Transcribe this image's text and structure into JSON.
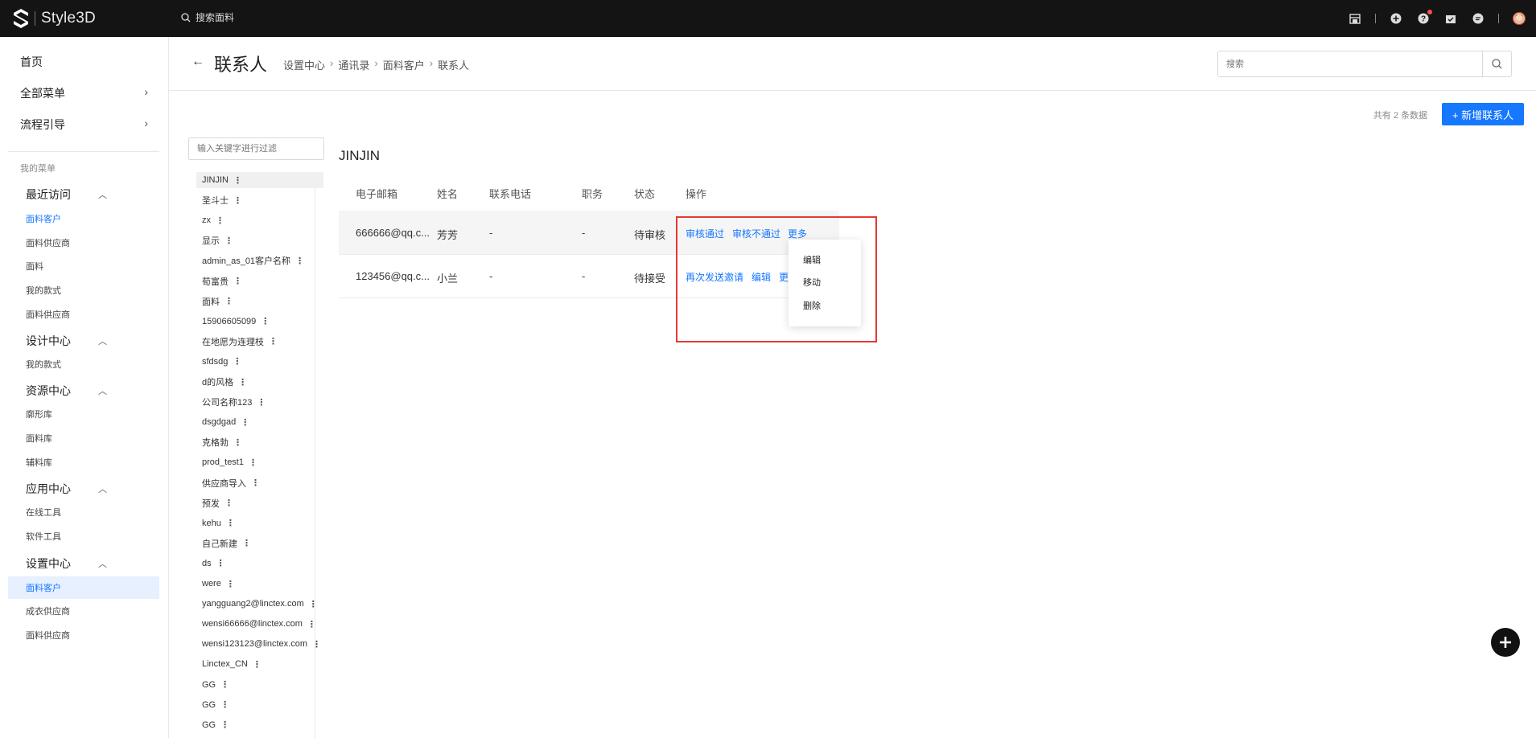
{
  "app": {
    "brand": "Style3D"
  },
  "topbar": {
    "search_label": "搜索面料"
  },
  "sidebar": {
    "home": "首页",
    "all_menu": "全部菜单",
    "flow_guide": "流程引导",
    "my_menu": "我的菜单",
    "groups": [
      {
        "label": "最近访问",
        "items": [
          "面料客户",
          "面料供应商",
          "面料",
          "我的款式",
          "面料供应商"
        ]
      },
      {
        "label": "设计中心",
        "items": [
          "我的款式"
        ]
      },
      {
        "label": "资源中心",
        "items": [
          "廓形库",
          "面料库",
          "辅料库"
        ]
      },
      {
        "label": "应用中心",
        "items": [
          "在线工具",
          "软件工具"
        ]
      },
      {
        "label": "设置中心",
        "items": [
          "面料客户",
          "成衣供应商",
          "面料供应商"
        ]
      }
    ]
  },
  "header": {
    "back": "←",
    "title": "联系人",
    "breadcrumb": [
      "设置中心",
      "通讯录",
      "面料客户",
      "联系人"
    ],
    "search_placeholder": "搜索"
  },
  "toolbar": {
    "count_text": "共有 2 条数据",
    "add_button": "+ 新增联系人"
  },
  "client_filter": {
    "placeholder": "输入关键字进行过滤"
  },
  "clients": [
    "JINJIN",
    "圣斗士",
    "zx",
    "显示",
    "admin_as_01客户名称",
    "荀富贵",
    "面料",
    "15906605099",
    "在地愿为连理枝",
    "sfdsdg",
    "d的风格",
    "公司名称123",
    "dsgdgad",
    "克格勃",
    "prod_test1",
    "供应商导入",
    "预发",
    "kehu",
    "自己新建",
    "ds",
    "were",
    "yangguang2@linctex.com",
    "wensi66666@linctex.com",
    "wensi123123@linctex.com",
    "Linctex_CN",
    "GG",
    "GG",
    "GG"
  ],
  "group_title": "JINJIN",
  "table": {
    "headers": [
      "电子邮箱",
      "姓名",
      "联系电话",
      "职务",
      "状态",
      "操作"
    ],
    "rows": [
      {
        "email": "666666@qq.c...",
        "name": "芳芳",
        "phone": "-",
        "position": "-",
        "status": "待审核",
        "actions": [
          "审核通过",
          "审核不通过",
          "更多"
        ]
      },
      {
        "email": "123456@qq.c...",
        "name": "小兰",
        "phone": "-",
        "position": "-",
        "status": "待接受",
        "actions": [
          "再次发送邀请",
          "编辑",
          "更"
        ]
      }
    ]
  },
  "dropdown": {
    "items": [
      "编辑",
      "移动",
      "删除"
    ]
  },
  "colors": {
    "accent": "#1677ff",
    "topbar": "#141414",
    "highlight": "#e53935"
  },
  "icons": [
    "logo-icon",
    "search-icon",
    "store-icon",
    "plus-circle-icon",
    "help-icon",
    "calendar-icon",
    "chat-icon",
    "avatar",
    "chevron-right-icon",
    "chevron-up-icon",
    "kebab-icon",
    "plus-icon"
  ]
}
